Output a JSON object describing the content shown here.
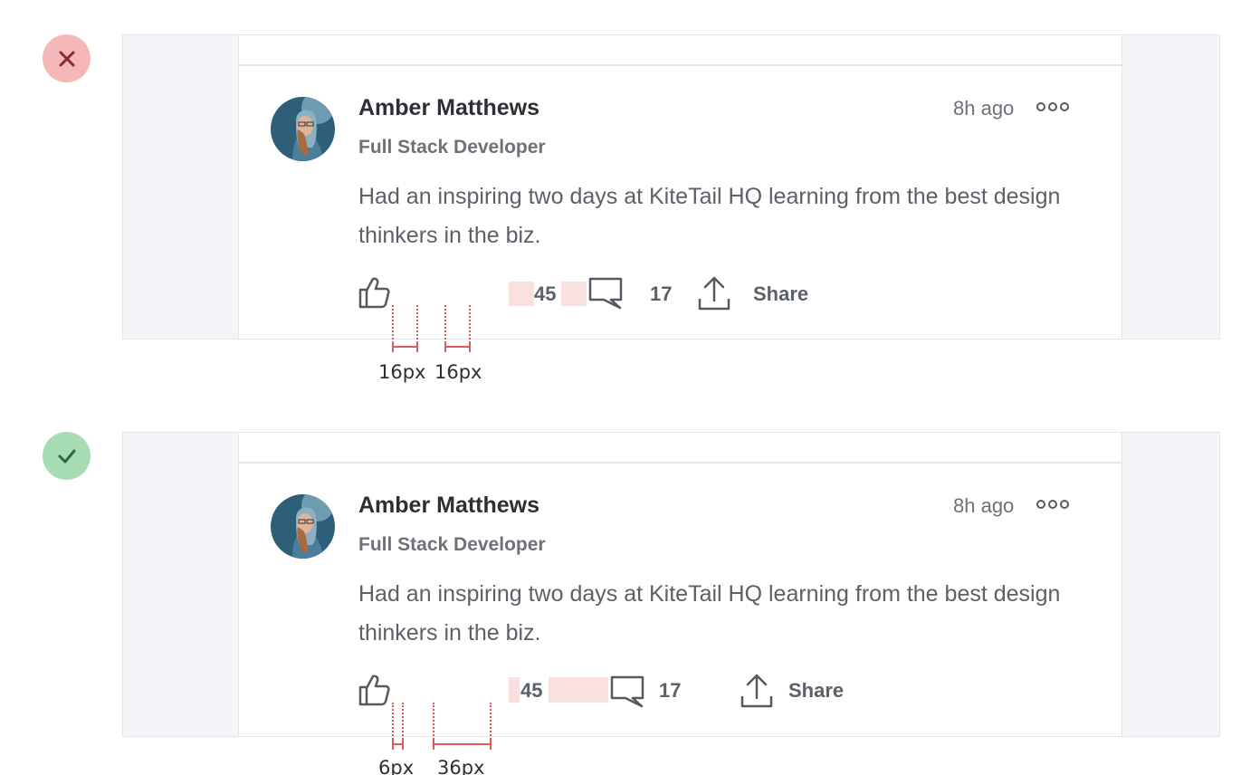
{
  "examples": [
    {
      "verdict": "incorrect",
      "verdict_icon": "close-icon",
      "post": {
        "author": "Amber Matthews",
        "role": "Full Stack Developer",
        "time": "8h ago",
        "text": "Had an inspiring two days at KiteTail HQ learning from the best design thinkers in the biz.",
        "likes": "45",
        "comments": "17",
        "share_label": "Share"
      },
      "measurements": [
        "16px",
        "16px"
      ]
    },
    {
      "verdict": "correct",
      "verdict_icon": "check-icon",
      "post": {
        "author": "Amber Matthews",
        "role": "Full Stack Developer",
        "time": "8h ago",
        "text": "Had an inspiring two days at KiteTail HQ learning from the best design thinkers in the biz.",
        "likes": "45",
        "comments": "17",
        "share_label": "Share"
      },
      "measurements": [
        "6px",
        "36px"
      ]
    }
  ],
  "colors": {
    "incorrect_badge": "#f5b8b8",
    "correct_badge": "#a8dcb4",
    "measure_line": "#e05a5a",
    "measure_highlight": "#fbe0e0"
  }
}
